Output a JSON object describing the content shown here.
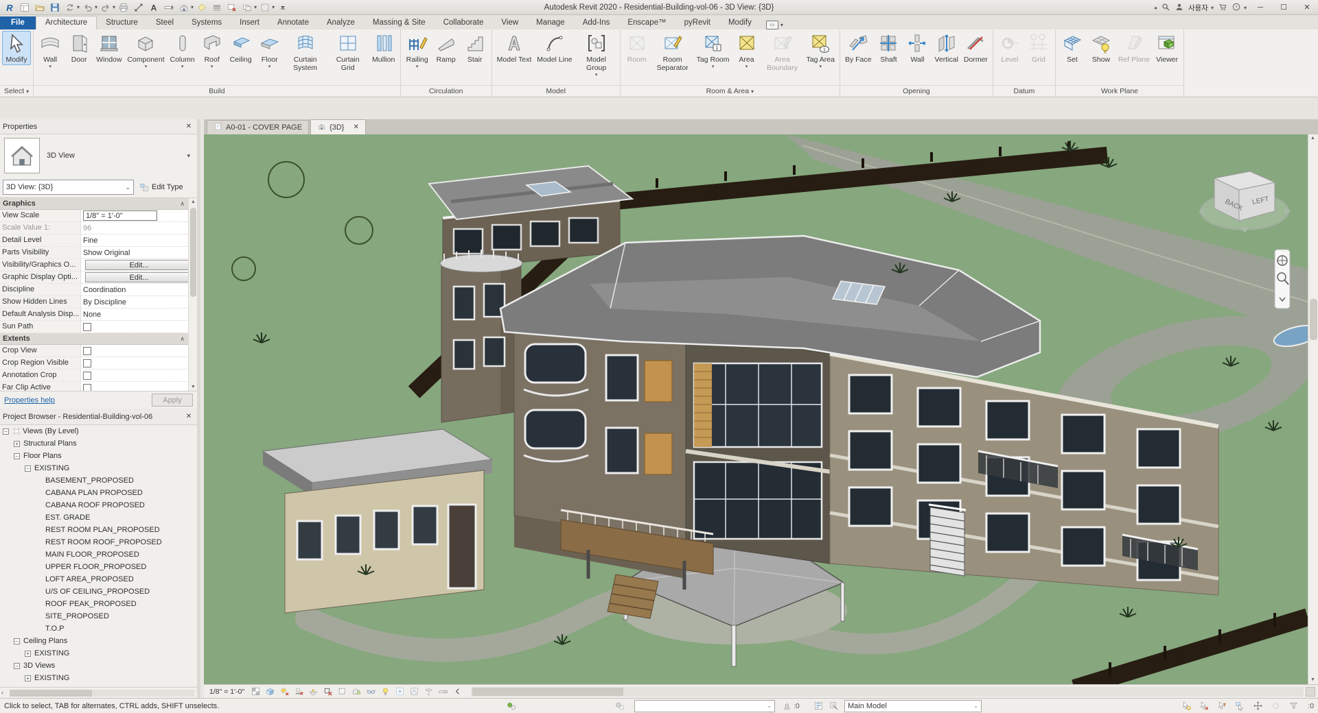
{
  "colors": {
    "canvas_green": "#87a77e",
    "file_tab_blue": "#1f62a8",
    "selection_blue": "#cde2f6",
    "road_gray": "#9ca195",
    "fence_dark": "#271d12"
  },
  "title_bar": {
    "app_title": "Autodesk Revit 2020 - Residential-Building-vol-06 - 3D View: {3D}",
    "qat_icons": [
      "revit-logo",
      "file-properties",
      "open",
      "save",
      "sync",
      "undo",
      "redo",
      "print",
      "measure",
      "text",
      "section",
      "default-3d-view",
      "render-gallery",
      "thin-lines",
      "close-hidden-windows",
      "switch-windows",
      "ui-grid",
      "customize-qat"
    ],
    "user_name": "사용자",
    "right_icons": [
      "search-icon",
      "account-icon",
      "cart-icon",
      "help-icon"
    ],
    "window_controls": {
      "minimize": "─",
      "maximize": "☐",
      "close": "✕"
    }
  },
  "ribbon": {
    "tabs": [
      {
        "label": "File",
        "style": "file"
      },
      {
        "label": "Architecture",
        "active": true
      },
      {
        "label": "Structure"
      },
      {
        "label": "Steel"
      },
      {
        "label": "Systems"
      },
      {
        "label": "Insert"
      },
      {
        "label": "Annotate"
      },
      {
        "label": "Analyze"
      },
      {
        "label": "Massing & Site"
      },
      {
        "label": "Collaborate"
      },
      {
        "label": "View"
      },
      {
        "label": "Manage"
      },
      {
        "label": "Add-Ins"
      },
      {
        "label": "Enscape™"
      },
      {
        "label": "pyRevit"
      },
      {
        "label": "Modify"
      }
    ],
    "panels": [
      {
        "label": "Select",
        "caret": true,
        "id": "select-panel",
        "buttons": [
          {
            "label": "Modify",
            "icon": "modify-icon",
            "selected": true
          }
        ]
      },
      {
        "label": "Build",
        "buttons": [
          {
            "label": "Wall",
            "icon": "wall-icon",
            "dropdown": true
          },
          {
            "label": "Door",
            "icon": "door-icon"
          },
          {
            "label": "Window",
            "icon": "window-icon"
          },
          {
            "label": "Component",
            "icon": "component-icon",
            "dropdown": true
          },
          {
            "label": "Column",
            "icon": "column-icon",
            "dropdown": true
          },
          {
            "label": "Roof",
            "icon": "roof-icon",
            "dropdown": true
          },
          {
            "label": "Ceiling",
            "icon": "ceiling-icon"
          },
          {
            "label": "Floor",
            "icon": "floor-icon",
            "dropdown": true
          },
          {
            "label": "Curtain System",
            "icon": "curtain-system-icon"
          },
          {
            "label": "Curtain Grid",
            "icon": "curtain-grid-icon"
          },
          {
            "label": "Mullion",
            "icon": "mullion-icon"
          }
        ]
      },
      {
        "label": "Circulation",
        "buttons": [
          {
            "label": "Railing",
            "icon": "railing-icon",
            "dropdown": true
          },
          {
            "label": "Ramp",
            "icon": "ramp-icon"
          },
          {
            "label": "Stair",
            "icon": "stair-icon"
          }
        ]
      },
      {
        "label": "Model",
        "buttons": [
          {
            "label": "Model Text",
            "icon": "model-text-icon"
          },
          {
            "label": "Model Line",
            "icon": "model-line-icon"
          },
          {
            "label": "Model Group",
            "icon": "model-group-icon",
            "dropdown": true
          }
        ]
      },
      {
        "label": "Room & Area",
        "caret": true,
        "buttons": [
          {
            "label": "Room",
            "icon": "room-icon",
            "disabled": true
          },
          {
            "label": "Room Separator",
            "icon": "room-separator-icon"
          },
          {
            "label": "Tag Room",
            "icon": "tag-room-icon",
            "dropdown": true
          },
          {
            "label": "Area",
            "icon": "area-icon",
            "dropdown": true
          },
          {
            "label": "Area Boundary",
            "icon": "area-boundary-icon",
            "disabled": true
          },
          {
            "label": "Tag Area",
            "icon": "tag-area-icon",
            "dropdown": true
          }
        ]
      },
      {
        "label": "Opening",
        "buttons": [
          {
            "label": "By Face",
            "icon": "by-face-icon"
          },
          {
            "label": "Shaft",
            "icon": "shaft-icon"
          },
          {
            "label": "Wall",
            "icon": "wall-opening-icon"
          },
          {
            "label": "Vertical",
            "icon": "vertical-opening-icon"
          },
          {
            "label": "Dormer",
            "icon": "dormer-icon"
          }
        ]
      },
      {
        "label": "Datum",
        "buttons": [
          {
            "label": "Level",
            "icon": "level-icon",
            "disabled": true
          },
          {
            "label": "Grid",
            "icon": "grid-datum-icon",
            "disabled": true
          }
        ]
      },
      {
        "label": "Work Plane",
        "buttons": [
          {
            "label": "Set",
            "icon": "workplane-set-icon"
          },
          {
            "label": "Show",
            "icon": "workplane-show-icon"
          },
          {
            "label": "Ref Plane",
            "icon": "ref-plane-icon",
            "disabled": true
          },
          {
            "label": "Viewer",
            "icon": "viewer-icon"
          }
        ]
      }
    ]
  },
  "properties_panel": {
    "header": "Properties",
    "type_selector": {
      "label": "3D View",
      "thumb_icon": "3d-view-thumb"
    },
    "instance_selector": {
      "value": "3D View: {3D}",
      "edit_type_label": "Edit Type"
    },
    "sections": [
      {
        "title": "Graphics",
        "rows": [
          {
            "label": "View Scale",
            "value": "1/8\" = 1'-0\"",
            "kind": "input"
          },
          {
            "label": "Scale Value    1:",
            "value": "96",
            "kind": "disabled"
          },
          {
            "label": "Detail Level",
            "value": "Fine"
          },
          {
            "label": "Parts Visibility",
            "value": "Show Original"
          },
          {
            "label": "Visibility/Graphics O...",
            "value": "Edit...",
            "kind": "button"
          },
          {
            "label": "Graphic Display Opti...",
            "value": "Edit...",
            "kind": "button"
          },
          {
            "label": "Discipline",
            "value": "Coordination"
          },
          {
            "label": "Show Hidden Lines",
            "value": "By Discipline"
          },
          {
            "label": "Default Analysis Disp...",
            "value": "None"
          },
          {
            "label": "Sun Path",
            "kind": "checkbox",
            "checked": false
          }
        ]
      },
      {
        "title": "Extents",
        "rows": [
          {
            "label": "Crop View",
            "kind": "checkbox",
            "checked": false
          },
          {
            "label": "Crop Region Visible",
            "kind": "checkbox",
            "checked": false
          },
          {
            "label": "Annotation Crop",
            "kind": "checkbox",
            "checked": false
          },
          {
            "label": "Far Clip Active",
            "kind": "checkbox",
            "checked": false
          }
        ]
      }
    ],
    "help_link": "Properties help",
    "apply_label": "Apply"
  },
  "project_browser": {
    "header": "Project Browser - Residential-Building-vol-06",
    "tree": [
      {
        "label": "Views (By Level)",
        "depth": 0,
        "expander": "minus",
        "icon": "views-icon"
      },
      {
        "label": "Structural Plans",
        "depth": 1,
        "expander": "plus"
      },
      {
        "label": "Floor Plans",
        "depth": 1,
        "expander": "minus"
      },
      {
        "label": "EXISTING",
        "depth": 2,
        "expander": "minus"
      },
      {
        "label": "BASEMENT_PROPOSED",
        "depth": 3
      },
      {
        "label": "CABANA PLAN PROPOSED",
        "depth": 3
      },
      {
        "label": "CABANA ROOF PROPOSED",
        "depth": 3
      },
      {
        "label": "EST. GRADE",
        "depth": 3
      },
      {
        "label": "REST ROOM PLAN_PROPOSED",
        "depth": 3
      },
      {
        "label": "REST ROOM ROOF_PROPOSED",
        "depth": 3
      },
      {
        "label": "MAIN FLOOR_PROPOSED",
        "depth": 3
      },
      {
        "label": "UPPER FLOOR_PROPOSED",
        "depth": 3
      },
      {
        "label": "LOFT AREA_PROPOSED",
        "depth": 3
      },
      {
        "label": "U/S OF CEILING_PROPOSED",
        "depth": 3
      },
      {
        "label": "ROOF PEAK_PROPOSED",
        "depth": 3
      },
      {
        "label": "SITE_PROPOSED",
        "depth": 3
      },
      {
        "label": "T.O.P",
        "depth": 3
      },
      {
        "label": "Ceiling Plans",
        "depth": 1,
        "expander": "minus"
      },
      {
        "label": "EXISTING",
        "depth": 2,
        "expander": "plus"
      },
      {
        "label": "3D Views",
        "depth": 1,
        "expander": "minus"
      },
      {
        "label": "EXISTING",
        "depth": 2,
        "expander": "plus"
      }
    ]
  },
  "view_tabs": [
    {
      "label": "A0-01 - COVER PAGE",
      "icon": "sheet-icon"
    },
    {
      "label": "{3D}",
      "icon": "3d-view-icon",
      "active": true,
      "closable": true
    }
  ],
  "canvas": {
    "view_cube": {
      "top_face": "",
      "left_face": "BACK",
      "right_face": "LEFT"
    }
  },
  "view_control_bar": {
    "scale": "1/8\" = 1'-0\"",
    "icons": [
      "visual-style-icon",
      "detail-level-icon",
      "sun-path-icon",
      "shadows-icon",
      "render-icon",
      "crop-view-icon",
      "show-crop-icon",
      "unlock-view-icon",
      "temporary-hide-icon",
      "reveal-hidden-icon",
      "temporary-view-properties-icon",
      "hide-analytical-icon",
      "displacement-icon",
      "reveal-constraints-icon",
      "collapse-icon"
    ]
  },
  "status_bar": {
    "hint": "Click to select, TAB for alternates, CTRL adds, SHIFT unselects.",
    "active_workset_icon": "active-workset-icon",
    "worksets_icon": "worksets-icon",
    "worksets_value": "",
    "editing_requests": ":0",
    "design_options_value": "Main Model",
    "right_icons": [
      "select-links-icon",
      "select-underlay-icon",
      "select-pinned-icon",
      "select-by-face-icon",
      "drag-elements-icon",
      "spinner-icon"
    ],
    "selection_count": ":0"
  }
}
